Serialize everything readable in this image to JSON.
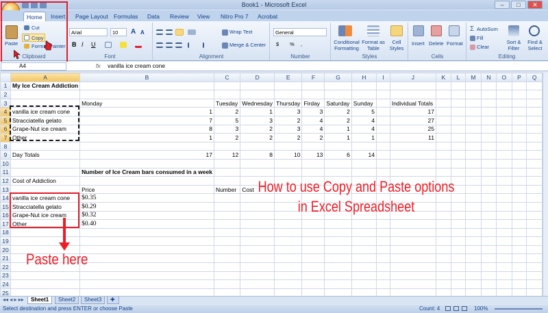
{
  "window": {
    "title": "Book1 - Microsoft Excel",
    "buttons": [
      "–",
      "□",
      "✕"
    ]
  },
  "ribbon_tabs": [
    "Home",
    "Insert",
    "Page Layout",
    "Formulas",
    "Data",
    "Review",
    "View",
    "Nitro Pro 7",
    "Acrobat"
  ],
  "ribbon": {
    "clipboard": {
      "paste": "Paste",
      "cut": "Cut",
      "copy": "Copy",
      "format_painter": "Format Painter",
      "label": "Clipboard"
    },
    "font": {
      "family": "Arial",
      "size": "10",
      "label": "Font",
      "bold": "B",
      "italic": "I",
      "underline": "U",
      "grow": "A",
      "shrink": "A"
    },
    "alignment": {
      "wrap": "Wrap Text",
      "merge": "Merge & Center",
      "label": "Alignment"
    },
    "number": {
      "format": "General",
      "currency": "$",
      "percent": "%",
      "comma": ",",
      "label": "Number"
    },
    "styles": {
      "conditional": "Conditional Formatting",
      "format_table": "Format as Table",
      "cell_styles": "Cell Styles",
      "label": "Styles"
    },
    "cells": {
      "insert": "Insert",
      "delete": "Delete",
      "format": "Format",
      "label": "Cells"
    },
    "editing": {
      "autosum": "AutoSum",
      "fill": "Fill",
      "clear": "Clear",
      "sort": "Sort & Filter",
      "find": "Find & Select",
      "label": "Editing"
    }
  },
  "formula_bar": {
    "name_box": "A4",
    "fx": "fx",
    "formula": "vanilla ice cream cone"
  },
  "columns": [
    "A",
    "B",
    "C",
    "D",
    "E",
    "F",
    "G",
    "H",
    "I",
    "J",
    "K",
    "L",
    "M",
    "N",
    "O",
    "P",
    "Q"
  ],
  "rows": [
    {
      "n": "1",
      "cells": [
        "My Ice Cream  Addiction",
        "",
        "",
        "",
        "",
        "",
        "",
        "",
        "",
        "",
        "",
        "",
        "",
        "",
        "",
        "",
        ""
      ]
    },
    {
      "n": "2",
      "cells": [
        "",
        "",
        "",
        "",
        "",
        "",
        "",
        "",
        "",
        "",
        "",
        "",
        "",
        "",
        "",
        "",
        ""
      ]
    },
    {
      "n": "3",
      "cells": [
        "",
        "Monday",
        "Tuesday",
        "Wednesday",
        "Thursday",
        "Firday",
        "Saturday",
        "Sunday",
        "",
        "Individual Totals",
        "",
        "",
        "",
        "",
        "",
        "",
        ""
      ]
    },
    {
      "n": "4",
      "cells": [
        "vanilla ice cream cone",
        "1",
        "2",
        "1",
        "3",
        "3",
        "2",
        "5",
        "",
        "17",
        "",
        "",
        "",
        "",
        "",
        "",
        ""
      ]
    },
    {
      "n": "5",
      "cells": [
        "Stracciatella gelato",
        "7",
        "5",
        "3",
        "2",
        "4",
        "2",
        "4",
        "",
        "27",
        "",
        "",
        "",
        "",
        "",
        "",
        ""
      ]
    },
    {
      "n": "6",
      "cells": [
        "Grape-Nut ice cream",
        "8",
        "3",
        "2",
        "3",
        "4",
        "1",
        "4",
        "",
        "25",
        "",
        "",
        "",
        "",
        "",
        "",
        ""
      ]
    },
    {
      "n": "7",
      "cells": [
        "Other",
        "1",
        "2",
        "2",
        "2",
        "2",
        "1",
        "1",
        "",
        "11",
        "",
        "",
        "",
        "",
        "",
        "",
        ""
      ]
    },
    {
      "n": "8",
      "cells": [
        "",
        "",
        "",
        "",
        "",
        "",
        "",
        "",
        "",
        "",
        "",
        "",
        "",
        "",
        "",
        "",
        ""
      ]
    },
    {
      "n": "9",
      "cells": [
        "Day Totals",
        "17",
        "12",
        "8",
        "10",
        "13",
        "6",
        "14",
        "",
        "",
        "",
        "",
        "",
        "",
        "",
        "",
        ""
      ]
    },
    {
      "n": "10",
      "cells": [
        "",
        "",
        "",
        "",
        "",
        "",
        "",
        "",
        "",
        "",
        "",
        "",
        "",
        "",
        "",
        "",
        ""
      ]
    },
    {
      "n": "11",
      "cells": [
        "",
        "Number of Ice Cream bars consumed in a week",
        "",
        "",
        "",
        "",
        "",
        "",
        "",
        "",
        "",
        "",
        "",
        "",
        "",
        "",
        ""
      ]
    },
    {
      "n": "12",
      "cells": [
        "Cost of Addiction",
        "",
        "",
        "",
        "",
        "",
        "",
        "",
        "",
        "",
        "",
        "",
        "",
        "",
        "",
        "",
        ""
      ]
    },
    {
      "n": "13",
      "cells": [
        "",
        "Price",
        "Number",
        "Cost",
        "",
        "",
        "",
        "",
        "",
        "",
        "",
        "",
        "",
        "",
        "",
        "",
        ""
      ]
    },
    {
      "n": "14",
      "cells": [
        "vanilla ice cream cone",
        "$0.35",
        "",
        "",
        "",
        "",
        "",
        "",
        "",
        "",
        "",
        "",
        "",
        "",
        "",
        "",
        ""
      ]
    },
    {
      "n": "15",
      "cells": [
        "Stracciatella gelato",
        "$0.29",
        "",
        "",
        "",
        "",
        "",
        "",
        "",
        "",
        "",
        "",
        "",
        "",
        "",
        "",
        ""
      ]
    },
    {
      "n": "16",
      "cells": [
        "Grape-Nut ice cream",
        "$0.32",
        "",
        "",
        "",
        "",
        "",
        "",
        "",
        "",
        "",
        "",
        "",
        "",
        "",
        "",
        ""
      ]
    },
    {
      "n": "17",
      "cells": [
        "Other",
        "$0.40",
        "",
        "",
        "",
        "",
        "",
        "",
        "",
        "",
        "",
        "",
        "",
        "",
        "",
        "",
        ""
      ]
    },
    {
      "n": "18",
      "cells": [
        "",
        "",
        "",
        "",
        "",
        "",
        "",
        "",
        "",
        "",
        "",
        "",
        "",
        "",
        "",
        "",
        ""
      ]
    },
    {
      "n": "19",
      "cells": [
        "",
        "",
        "",
        "",
        "",
        "",
        "",
        "",
        "",
        "",
        "",
        "",
        "",
        "",
        "",
        "",
        ""
      ]
    },
    {
      "n": "20",
      "cells": [
        "",
        "",
        "",
        "",
        "",
        "",
        "",
        "",
        "",
        "",
        "",
        "",
        "",
        "",
        "",
        "",
        ""
      ]
    },
    {
      "n": "21",
      "cells": [
        "",
        "",
        "",
        "",
        "",
        "",
        "",
        "",
        "",
        "",
        "",
        "",
        "",
        "",
        "",
        "",
        ""
      ]
    },
    {
      "n": "22",
      "cells": [
        "",
        "",
        "",
        "",
        "",
        "",
        "",
        "",
        "",
        "",
        "",
        "",
        "",
        "",
        "",
        "",
        ""
      ]
    },
    {
      "n": "23",
      "cells": [
        "",
        "",
        "",
        "",
        "",
        "",
        "",
        "",
        "",
        "",
        "",
        "",
        "",
        "",
        "",
        "",
        ""
      ]
    },
    {
      "n": "24",
      "cells": [
        "",
        "",
        "",
        "",
        "",
        "",
        "",
        "",
        "",
        "",
        "",
        "",
        "",
        "",
        "",
        "",
        ""
      ]
    },
    {
      "n": "25",
      "cells": [
        "",
        "",
        "",
        "",
        "",
        "",
        "",
        "",
        "",
        "",
        "",
        "",
        "",
        "",
        "",
        "",
        ""
      ]
    }
  ],
  "sheet_tabs": [
    "Sheet1",
    "Sheet2",
    "Sheet3"
  ],
  "status": {
    "message": "Select destination and press ENTER or choose Paste",
    "count": "Count: 4",
    "zoom": "100%"
  },
  "overlay": {
    "title_line1": "How to use Copy and Paste options",
    "title_line2": "in Excel Spreadsheet",
    "paste_here": "Paste here"
  },
  "colors": {
    "annotation_red": "#ee1c25",
    "ribbon_blue": "#15428b"
  }
}
